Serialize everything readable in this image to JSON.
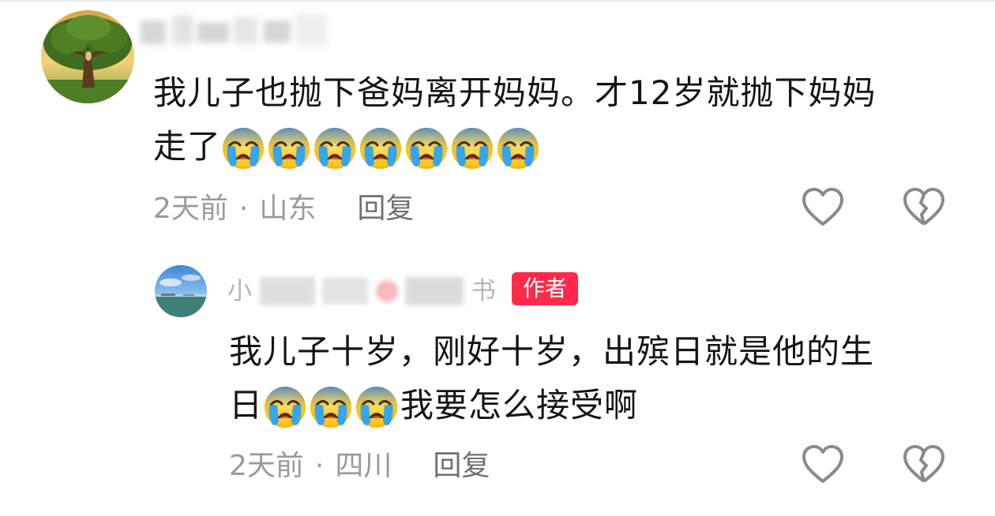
{
  "comment": {
    "text_line1": "我儿子也抛下爸妈离开妈妈。才12岁就抛下妈妈",
    "text_line2_prefix": "走了",
    "emoji": "loudly-crying-face",
    "emoji_count": 7,
    "time": "2天前",
    "separator": "·",
    "location": "山东",
    "reply_label": "回复"
  },
  "reply": {
    "username_visible_start": "小",
    "username_visible_end": "书",
    "author_badge": "作者",
    "text_line1": "我儿子十岁，刚好十岁，出殡日就是他的生",
    "text_line2_prefix": "日",
    "emoji": "loudly-crying-face",
    "emoji_count": 3,
    "text_line2_suffix": "我要怎么接受啊",
    "time": "2天前",
    "separator": "·",
    "location": "四川",
    "reply_label": "回复"
  },
  "icons": {
    "like": "heart-outline-icon",
    "dislike": "broken-heart-icon"
  },
  "colors": {
    "badge": "#ff2a4b",
    "meta_text": "#9a9a9a",
    "icon_stroke": "#8a8a8a"
  }
}
